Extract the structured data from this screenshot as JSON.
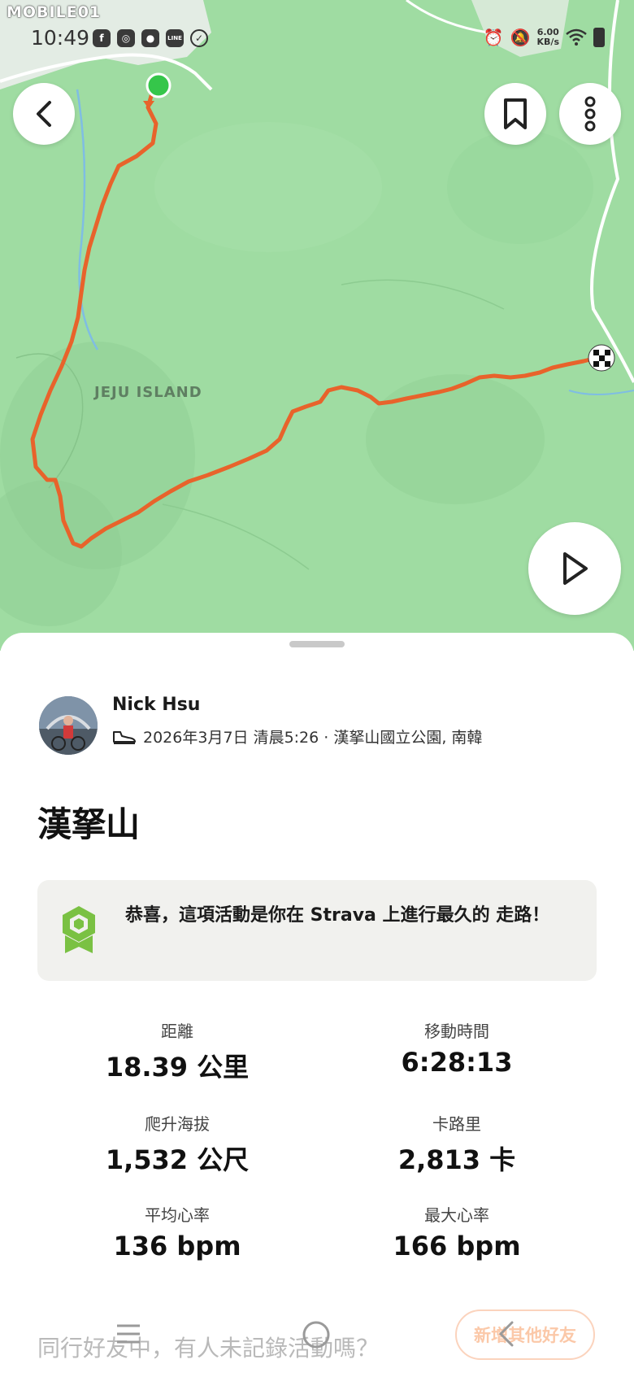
{
  "watermark": "MOBILE01",
  "status_bar": {
    "time": "10:49",
    "app_icons": [
      "facebook-icon",
      "instagram-icon",
      "teams-icon",
      "line-icon",
      "check-icon"
    ],
    "line_label": "LINE",
    "speed_value": "6.00",
    "speed_unit": "KB/s"
  },
  "map": {
    "region_label": "JEJU ISLAND",
    "route_color": "#e8632b",
    "land_color": "#9fdca2",
    "start_color": "#35c64a"
  },
  "header_buttons": {
    "back": "chevron-left-icon",
    "bookmark": "bookmark-icon",
    "more": "more-vertical-icon",
    "play": "play-icon"
  },
  "athlete": {
    "name": "Nick Hsu",
    "activity_icon": "shoe-icon",
    "meta": "2026年3月7日 清晨5:26 · 漢拏山國立公園, 南韓"
  },
  "activity": {
    "title": "漢拏山",
    "achievement_icon": "award-badge-icon",
    "achievement_text": "恭喜，這項活動是你在 Strava 上進行最久的 走路！"
  },
  "stats": [
    {
      "label": "距離",
      "value": "18.39 公里"
    },
    {
      "label": "移動時間",
      "value": "6:28:13"
    },
    {
      "label": "爬升海拔",
      "value": "1,532 公尺"
    },
    {
      "label": "卡路里",
      "value": "2,813 卡"
    },
    {
      "label": "平均心率",
      "value": "136 bpm"
    },
    {
      "label": "最大心率",
      "value": "166 bpm"
    }
  ],
  "invite": {
    "prompt": "同行好友中，有人未記錄活動嗎？",
    "button": "新增其他好友"
  },
  "system_nav": [
    "menu-icon",
    "home-icon",
    "back-nav-icon"
  ]
}
